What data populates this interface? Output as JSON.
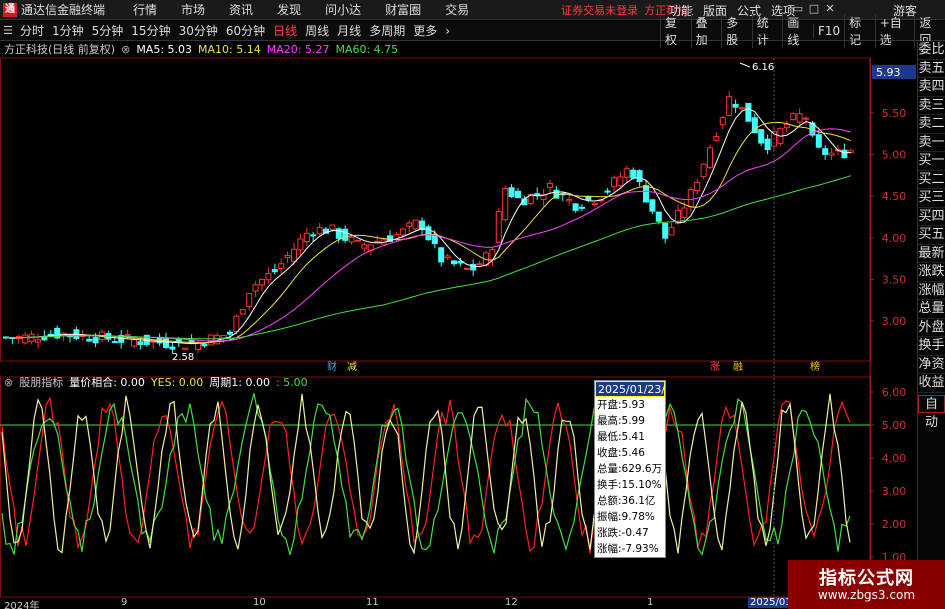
{
  "titlebar": {
    "app_title": "通达信金融终端",
    "menus": [
      "行情",
      "市场",
      "资讯",
      "发现",
      "问小达",
      "财富圈",
      "交易"
    ],
    "broker_status": "证券交易未登录",
    "broker_name": "方正科技",
    "right_menus": [
      "功能",
      "版面",
      "公式",
      "选项"
    ],
    "guest": "游客"
  },
  "toolbar": {
    "periods": [
      "分时",
      "1分钟",
      "5分钟",
      "15分钟",
      "30分钟",
      "60分钟",
      "日线",
      "周线",
      "月线",
      "多周期",
      "更多"
    ],
    "active_period": "日线",
    "right_buttons": [
      "复权",
      "叠加",
      "多股",
      "统计",
      "画线",
      "F10",
      "标记",
      "+自选",
      "返回"
    ]
  },
  "main_legend": {
    "stock": "方正科技(日线 前复权)",
    "ma5": "MA5: 5.03",
    "ma10": "MA10: 5.14",
    "ma20": "MA20: 5.27",
    "ma60": "MA60: 4.75"
  },
  "sub_legend": {
    "name": "股朋指标",
    "vol": "量价相合: 0.00",
    "yes": "YES: 0.00",
    "zq": "周期1: 0.00",
    "last": ": 5.00"
  },
  "side_panel": [
    "委比",
    "卖五",
    "卖四",
    "卖三",
    "卖二",
    "卖一",
    "买一",
    "买二",
    "买三",
    "买四",
    "买五",
    "最新",
    "涨跌",
    "涨幅",
    "总量",
    "外盘",
    "换手",
    "净资",
    "收益",
    "自动"
  ],
  "tooltip": {
    "date": "2025/01/23/四",
    "rows": [
      "开盘:5.93",
      "最高:5.99",
      "最低:5.41",
      "收盘:5.46",
      "总量:629.6万",
      "换手:15.10%",
      "总额:36.1亿",
      "振幅:9.78%",
      "涨跌:-0.47",
      "涨幅:-7.93%"
    ]
  },
  "price_axis": [
    "5.50",
    "5.00",
    "4.50",
    "4.00",
    "3.50",
    "3.00"
  ],
  "price_current": "5.93",
  "sub_axis": [
    "6.00",
    "5.00",
    "4.00",
    "3.00",
    "2.00",
    "1.00"
  ],
  "x_axis": [
    "2024年",
    "9",
    "10",
    "11",
    "12",
    "1",
    "2025/01"
  ],
  "annotations": {
    "high": "6.16",
    "low": "2.58",
    "markers": [
      "财",
      "减",
      "涨",
      "融",
      "榜"
    ]
  },
  "watermark": {
    "big": "指标公式网",
    "small": "www.zbgs3.com"
  },
  "colors": {
    "up": "#ff3030",
    "down": "#40ffff",
    "ma5": "#ffffff",
    "ma10": "#f0e040",
    "ma20": "#ff40ff",
    "ma60": "#40e040"
  }
}
